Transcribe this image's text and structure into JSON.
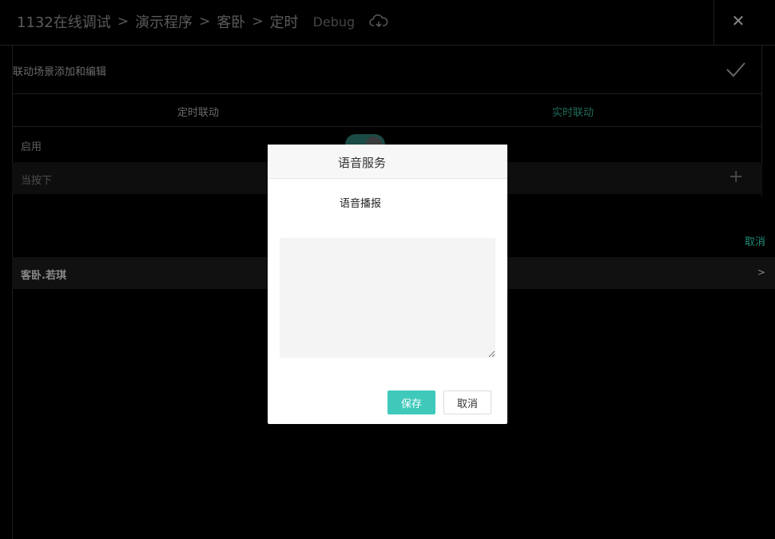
{
  "header": {
    "breadcrumbs": [
      "1132在线调试",
      "演示程序",
      "客卧",
      "定时"
    ],
    "separator": ">",
    "debug_label": "Debug",
    "cloud_icon": "cloud-sync-icon",
    "close_label": "✕"
  },
  "section": {
    "title": "联动场景添加和编辑",
    "confirm_icon": "checkmark-icon"
  },
  "tabs": [
    {
      "label": "定时联动",
      "active": false
    },
    {
      "label": "实时联动",
      "active": true
    }
  ],
  "enable": {
    "label": "启用",
    "on": true
  },
  "when": {
    "label": "当按下",
    "add_label": "+"
  },
  "cancel_link": "取消",
  "device_row": {
    "label": "客卧.若琪",
    "arrow": ">"
  },
  "modal": {
    "title": "语音服务",
    "field_label": "语音播报",
    "text_value": "",
    "save_label": "保存",
    "cancel_label": "取消"
  },
  "colors": {
    "accent": "#3fc9ba",
    "link": "#1f8a76",
    "background": "#000000"
  }
}
